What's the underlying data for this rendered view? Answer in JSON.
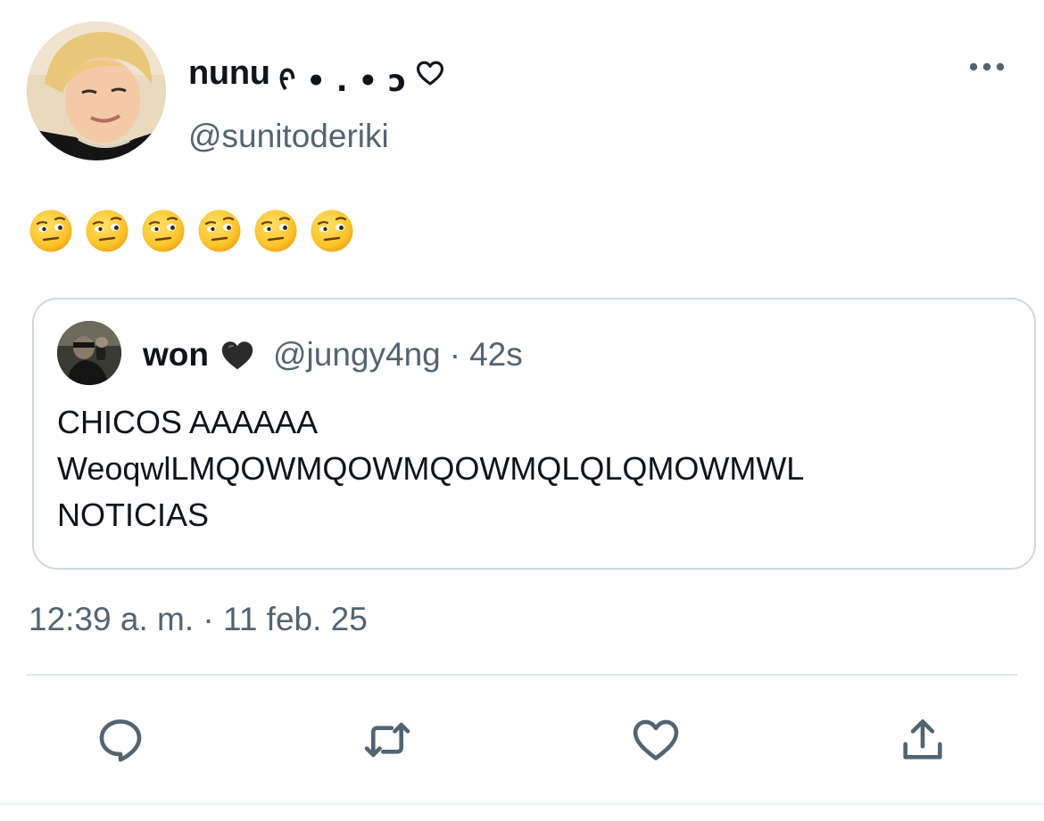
{
  "tweet": {
    "author": {
      "display_name": "nunu",
      "display_name_decoration": "ᠻ • . • ɔ",
      "username": "@sunitoderiki",
      "avatar": "profile-photo"
    },
    "body_emojis": [
      "🤨",
      "🤨",
      "🤨",
      "🤨",
      "🤨",
      "🤨"
    ],
    "quoted_tweet": {
      "author_name": "won",
      "author_emoji": "🖤",
      "handle": "@jungy4ng",
      "separator": "·",
      "relative_time": "42s",
      "text_lines": [
        "CHICOS AAAAAA",
        "WeoqwlLMQOWMQOWMQOWMQLQLQMOWMWL",
        "NOTICIAS"
      ]
    },
    "timestamp": "12:39 a. m. · 11 feb. 25"
  },
  "actions": {
    "reply_icon": "speech-bubble-icon",
    "retweet_icon": "retweet-icon",
    "like_icon": "heart-outline-icon",
    "share_icon": "share-icon"
  },
  "colors": {
    "text_primary": "#0f1419",
    "text_secondary": "#536471",
    "border": "#cfd9de"
  }
}
